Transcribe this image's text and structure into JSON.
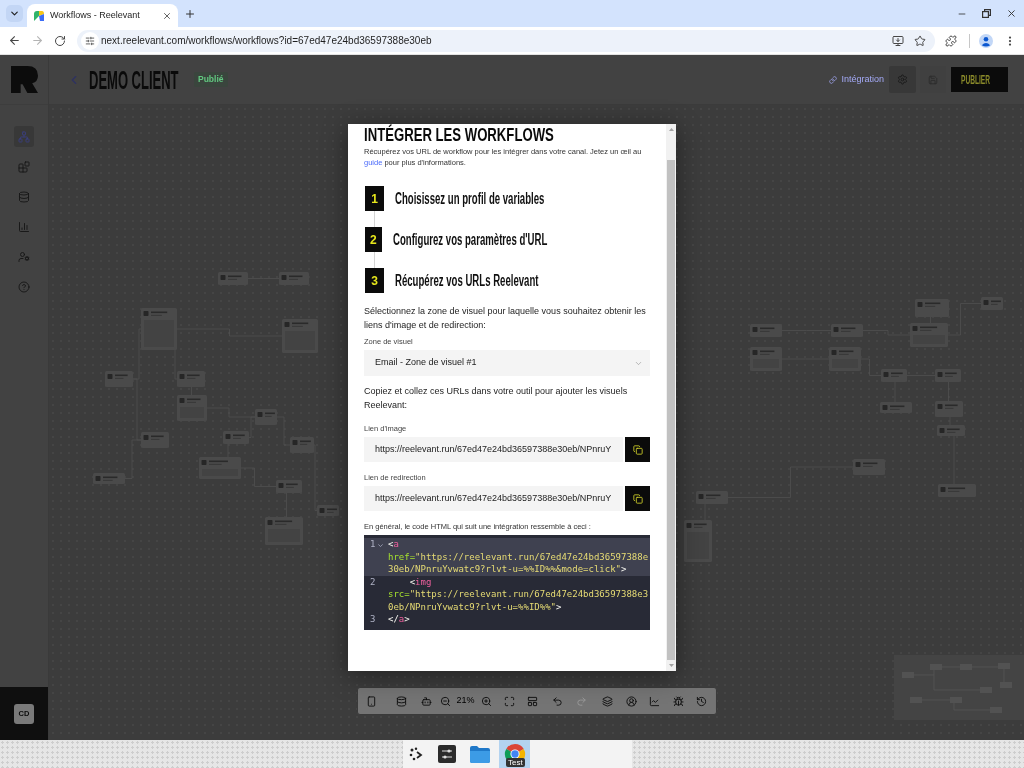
{
  "browser": {
    "tabs": [
      {
        "title": "Workflows - Reelevant",
        "selected": true
      }
    ],
    "url": "next.reelevant.com/workflows/workflows?id=67ed47e24bd36597388e30eb"
  },
  "app": {
    "sidebar": {
      "items": [
        {
          "selected": true
        },
        {
          "selected": false
        },
        {
          "selected": false
        },
        {
          "selected": false
        },
        {
          "selected": false
        },
        {
          "selected": false
        }
      ],
      "avatar": "CD"
    },
    "header": {
      "title": "DEMO CLIENT",
      "status": "Publié",
      "integration_link": "Intégration",
      "publish_button": "PUBLIER"
    },
    "toolbar": {
      "zoom": "21%",
      "undo": {
        "disabled": false
      },
      "redo": {
        "disabled": true
      }
    }
  },
  "modal": {
    "title": "INTÉGRER LES WORKFLOWS",
    "intro": {
      "text": "Récupérez vos URL de workflow pour les intégrer dans votre canal. Jetez un œil au",
      "link": "guide",
      "text_after": "pour plus d'informations."
    },
    "steps": [
      {
        "number": "1",
        "label": "Choisissez un profil de variables"
      },
      {
        "number": "2",
        "label": "Configurez vos paramètres d'URL"
      },
      {
        "number": "3",
        "label": "Récupérez vos URLs Reelevant"
      }
    ],
    "zone_prompt": "Sélectionnez la zone de visuel pour laquelle vous souhaitez obtenir les liens d'image et de redirection:",
    "zone_select": {
      "label": "Zone de visuel",
      "value": "Email - Zone de visuel #1"
    },
    "copy_prompt": "Copiez et collez ces URLs dans votre outil pour ajouter les visuels Reelevant:",
    "links": [
      {
        "label": "Lien d'image",
        "value": "https://reelevant.run/67ed47e24bd36597388e30eb/NPnruY"
      },
      {
        "label": "Lien de redirection",
        "value": "https://reelevant.run/67ed47e24bd36597388e30eb/NPnruY"
      }
    ],
    "code_caption": "En général, le code HTML qui suit une intégration ressemble à ceci :",
    "code": {
      "lines": [
        {
          "number": "1",
          "text": "<a href=\"https://reelevant.run/67ed47e24bd36597388e30eb/NPnruYvwatc9?rlvt-u=%%ID%%&mode=click\">",
          "active": true,
          "foldable": true
        },
        {
          "number": "2",
          "text": "    <img src=\"https://reelevant.run/67ed47e24bd36597388e30eb/NPnruYvwatc9?rlvt-u=%%ID%%\">",
          "active": false,
          "foldable": false
        },
        {
          "number": "3",
          "text": "</a>",
          "active": false,
          "foldable": false
        }
      ]
    }
  },
  "taskbar": {
    "apps": [
      {
        "selected": false
      },
      {
        "selected": false
      },
      {
        "selected": false
      },
      {
        "selected": true,
        "badge": "Test"
      }
    ]
  }
}
